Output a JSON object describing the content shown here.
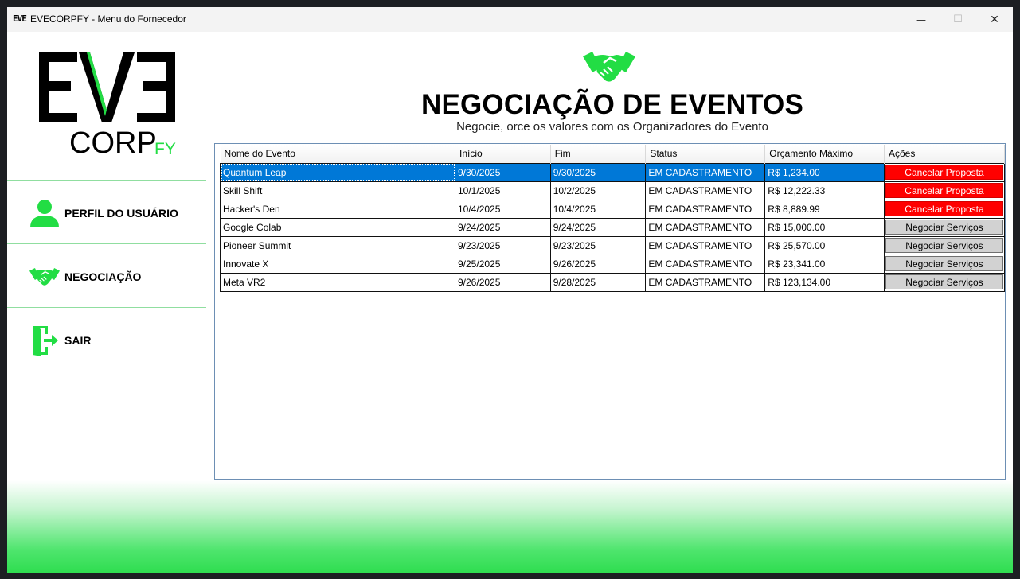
{
  "window": {
    "title": "EVECORPFY - Menu do Fornecedor",
    "app_icon": "EVE",
    "minimize_label": "—",
    "maximize_label": "☐",
    "close_label": "✕"
  },
  "logo": {
    "top_text": "EVE",
    "bottom_text": "CORP",
    "suffix_text": "FY"
  },
  "sidebar": {
    "items": [
      {
        "label": "PERFIL DO USUÁRIO",
        "icon": "user-icon"
      },
      {
        "label": "NEGOCIAÇÃO",
        "icon": "handshake-icon"
      },
      {
        "label": "SAIR",
        "icon": "exit-door-icon"
      }
    ]
  },
  "header": {
    "icon": "handshake-icon",
    "title": "NEGOCIAÇÃO DE EVENTOS",
    "subtitle": "Negocie, orce os valores com os Organizadores do Evento"
  },
  "table": {
    "columns": [
      "Nome do Evento",
      "Início",
      "Fim",
      "Status",
      "Orçamento Máximo",
      "Ações"
    ],
    "rows": [
      {
        "name": "Quantum Leap",
        "start": "9/30/2025",
        "end": "9/30/2025",
        "status": "EM CADASTRAMENTO",
        "budget": "R$ 1,234.00",
        "action": "Cancelar Proposta"
      },
      {
        "name": "Skill Shift",
        "start": "10/1/2025",
        "end": "10/2/2025",
        "status": "EM CADASTRAMENTO",
        "budget": "R$ 12,222.33",
        "action": "Cancelar Proposta"
      },
      {
        "name": "Hacker's Den",
        "start": "10/4/2025",
        "end": "10/4/2025",
        "status": "EM CADASTRAMENTO",
        "budget": "R$ 8,889.99",
        "action": "Cancelar Proposta"
      },
      {
        "name": "Google Colab",
        "start": "9/24/2025",
        "end": "9/24/2025",
        "status": "EM CADASTRAMENTO",
        "budget": "R$ 15,000.00",
        "action": "Negociar Serviços"
      },
      {
        "name": "Pioneer Summit",
        "start": "9/23/2025",
        "end": "9/23/2025",
        "status": "EM CADASTRAMENTO",
        "budget": "R$ 25,570.00",
        "action": "Negociar Serviços"
      },
      {
        "name": "Innovate X",
        "start": "9/25/2025",
        "end": "9/26/2025",
        "status": "EM CADASTRAMENTO",
        "budget": "R$ 23,341.00",
        "action": "Negociar Serviços"
      },
      {
        "name": "Meta VR2",
        "start": "9/26/2025",
        "end": "9/28/2025",
        "status": "EM CADASTRAMENTO",
        "budget": "R$ 123,134.00",
        "action": "Negociar Serviços"
      }
    ]
  },
  "colors": {
    "accent_green": "#22dd44",
    "selection_blue": "#0078d7",
    "cancel_red": "#ff0000",
    "negotiate_gray": "#d2d2d2"
  }
}
